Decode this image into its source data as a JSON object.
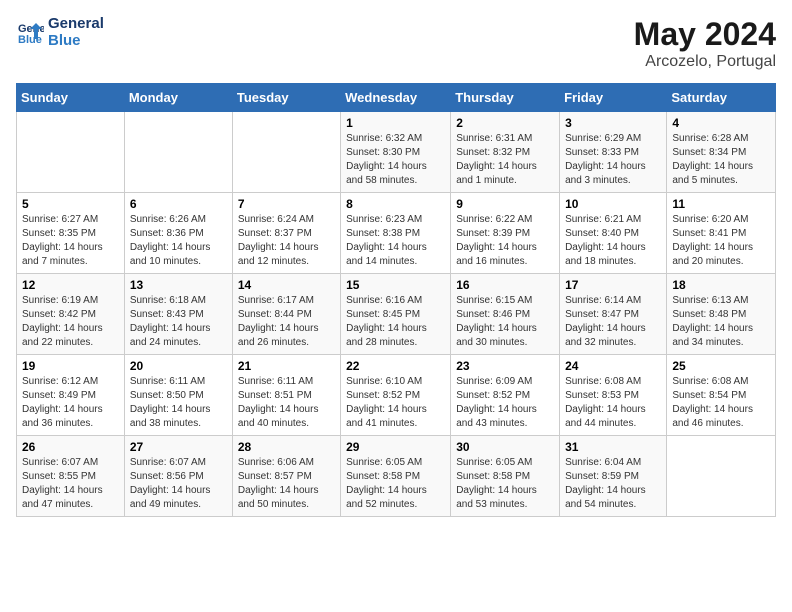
{
  "logo": {
    "line1": "General",
    "line2": "Blue"
  },
  "title": {
    "month_year": "May 2024",
    "location": "Arcozelo, Portugal"
  },
  "weekdays": [
    "Sunday",
    "Monday",
    "Tuesday",
    "Wednesday",
    "Thursday",
    "Friday",
    "Saturday"
  ],
  "weeks": [
    [
      {
        "day": "",
        "info": ""
      },
      {
        "day": "",
        "info": ""
      },
      {
        "day": "",
        "info": ""
      },
      {
        "day": "1",
        "info": "Sunrise: 6:32 AM\nSunset: 8:30 PM\nDaylight: 14 hours and 58 minutes."
      },
      {
        "day": "2",
        "info": "Sunrise: 6:31 AM\nSunset: 8:32 PM\nDaylight: 14 hours and 1 minute."
      },
      {
        "day": "3",
        "info": "Sunrise: 6:29 AM\nSunset: 8:33 PM\nDaylight: 14 hours and 3 minutes."
      },
      {
        "day": "4",
        "info": "Sunrise: 6:28 AM\nSunset: 8:34 PM\nDaylight: 14 hours and 5 minutes."
      }
    ],
    [
      {
        "day": "5",
        "info": "Sunrise: 6:27 AM\nSunset: 8:35 PM\nDaylight: 14 hours and 7 minutes."
      },
      {
        "day": "6",
        "info": "Sunrise: 6:26 AM\nSunset: 8:36 PM\nDaylight: 14 hours and 10 minutes."
      },
      {
        "day": "7",
        "info": "Sunrise: 6:24 AM\nSunset: 8:37 PM\nDaylight: 14 hours and 12 minutes."
      },
      {
        "day": "8",
        "info": "Sunrise: 6:23 AM\nSunset: 8:38 PM\nDaylight: 14 hours and 14 minutes."
      },
      {
        "day": "9",
        "info": "Sunrise: 6:22 AM\nSunset: 8:39 PM\nDaylight: 14 hours and 16 minutes."
      },
      {
        "day": "10",
        "info": "Sunrise: 6:21 AM\nSunset: 8:40 PM\nDaylight: 14 hours and 18 minutes."
      },
      {
        "day": "11",
        "info": "Sunrise: 6:20 AM\nSunset: 8:41 PM\nDaylight: 14 hours and 20 minutes."
      }
    ],
    [
      {
        "day": "12",
        "info": "Sunrise: 6:19 AM\nSunset: 8:42 PM\nDaylight: 14 hours and 22 minutes."
      },
      {
        "day": "13",
        "info": "Sunrise: 6:18 AM\nSunset: 8:43 PM\nDaylight: 14 hours and 24 minutes."
      },
      {
        "day": "14",
        "info": "Sunrise: 6:17 AM\nSunset: 8:44 PM\nDaylight: 14 hours and 26 minutes."
      },
      {
        "day": "15",
        "info": "Sunrise: 6:16 AM\nSunset: 8:45 PM\nDaylight: 14 hours and 28 minutes."
      },
      {
        "day": "16",
        "info": "Sunrise: 6:15 AM\nSunset: 8:46 PM\nDaylight: 14 hours and 30 minutes."
      },
      {
        "day": "17",
        "info": "Sunrise: 6:14 AM\nSunset: 8:47 PM\nDaylight: 14 hours and 32 minutes."
      },
      {
        "day": "18",
        "info": "Sunrise: 6:13 AM\nSunset: 8:48 PM\nDaylight: 14 hours and 34 minutes."
      }
    ],
    [
      {
        "day": "19",
        "info": "Sunrise: 6:12 AM\nSunset: 8:49 PM\nDaylight: 14 hours and 36 minutes."
      },
      {
        "day": "20",
        "info": "Sunrise: 6:11 AM\nSunset: 8:50 PM\nDaylight: 14 hours and 38 minutes."
      },
      {
        "day": "21",
        "info": "Sunrise: 6:11 AM\nSunset: 8:51 PM\nDaylight: 14 hours and 40 minutes."
      },
      {
        "day": "22",
        "info": "Sunrise: 6:10 AM\nSunset: 8:52 PM\nDaylight: 14 hours and 41 minutes."
      },
      {
        "day": "23",
        "info": "Sunrise: 6:09 AM\nSunset: 8:52 PM\nDaylight: 14 hours and 43 minutes."
      },
      {
        "day": "24",
        "info": "Sunrise: 6:08 AM\nSunset: 8:53 PM\nDaylight: 14 hours and 44 minutes."
      },
      {
        "day": "25",
        "info": "Sunrise: 6:08 AM\nSunset: 8:54 PM\nDaylight: 14 hours and 46 minutes."
      }
    ],
    [
      {
        "day": "26",
        "info": "Sunrise: 6:07 AM\nSunset: 8:55 PM\nDaylight: 14 hours and 47 minutes."
      },
      {
        "day": "27",
        "info": "Sunrise: 6:07 AM\nSunset: 8:56 PM\nDaylight: 14 hours and 49 minutes."
      },
      {
        "day": "28",
        "info": "Sunrise: 6:06 AM\nSunset: 8:57 PM\nDaylight: 14 hours and 50 minutes."
      },
      {
        "day": "29",
        "info": "Sunrise: 6:05 AM\nSunset: 8:58 PM\nDaylight: 14 hours and 52 minutes."
      },
      {
        "day": "30",
        "info": "Sunrise: 6:05 AM\nSunset: 8:58 PM\nDaylight: 14 hours and 53 minutes."
      },
      {
        "day": "31",
        "info": "Sunrise: 6:04 AM\nSunset: 8:59 PM\nDaylight: 14 hours and 54 minutes."
      },
      {
        "day": "",
        "info": ""
      }
    ]
  ]
}
